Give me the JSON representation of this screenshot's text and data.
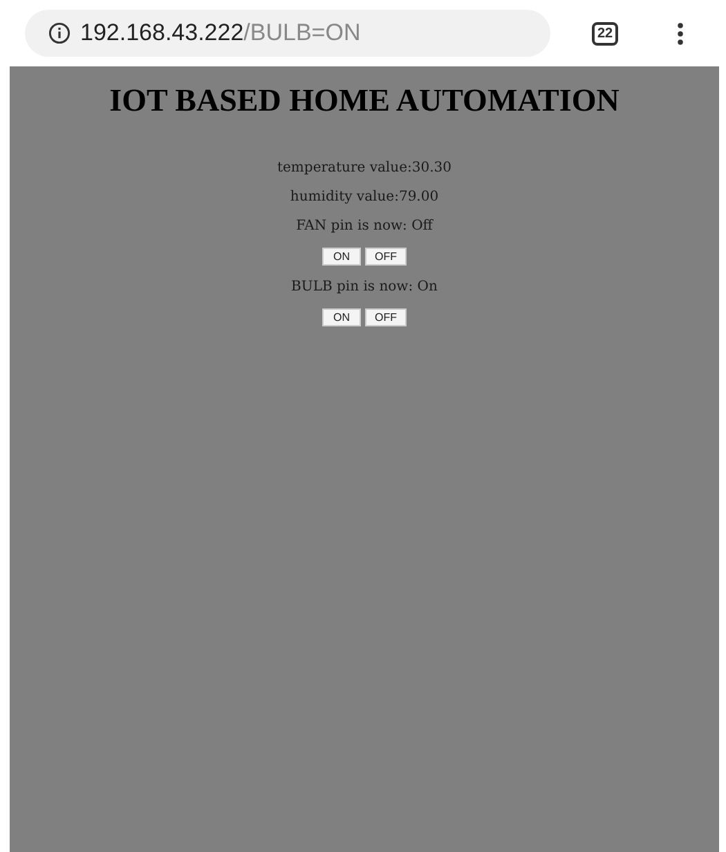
{
  "browser": {
    "url_host": "192.168.43.222",
    "url_path": "/BULB=ON",
    "tab_count": "22"
  },
  "page": {
    "title": "IOT BASED HOME AUTOMATION",
    "readings": [
      "temperature value:30.30",
      "humidity value:79.00"
    ],
    "devices": [
      {
        "status": "FAN pin is now: Off",
        "buttons": [
          "ON",
          "OFF"
        ]
      },
      {
        "status": "BULB pin is now: On",
        "buttons": [
          "ON",
          "OFF"
        ]
      }
    ]
  }
}
